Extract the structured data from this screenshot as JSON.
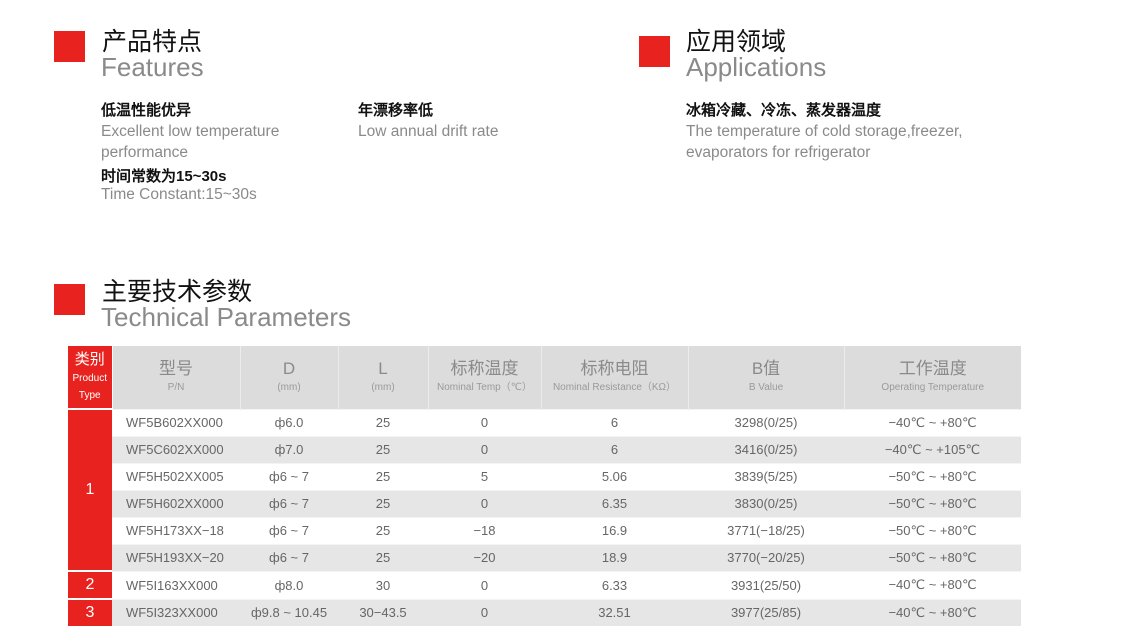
{
  "features": {
    "title_cn": "产品特点",
    "title_en": "Features",
    "items": [
      {
        "cn": "低温性能优异",
        "en": "Excellent low temperature performance"
      },
      {
        "cn": "年漂移率低",
        "en": "Low annual drift rate"
      },
      {
        "cn": "时间常数为15~30s",
        "en": "Time Constant:15~30s"
      }
    ]
  },
  "applications": {
    "title_cn": "应用领域",
    "title_en": "Applications",
    "item_cn": "冰箱冷藏、冷冻、蒸发器温度",
    "item_en": "The temperature of cold storage,freezer, evaporators for refrigerator"
  },
  "technical": {
    "title_cn": "主要技术参数",
    "title_en": "Technical Parameters"
  },
  "colors": {
    "accent": "#e8231f",
    "header_bg": "#dcdcdc",
    "stripe": "#e6e6e6"
  },
  "table": {
    "headers": [
      {
        "cn": "类别",
        "en1": "Product",
        "en2": "Type"
      },
      {
        "cn": "型号",
        "en": "P/N"
      },
      {
        "cn": "D",
        "en": "(mm)"
      },
      {
        "cn": "L",
        "en": "(mm)"
      },
      {
        "cn": "标称温度",
        "en": "Nominal Temp（℃）"
      },
      {
        "cn": "标称电阻",
        "en": "Nominal Resistance（KΩ）"
      },
      {
        "cn": "B值",
        "en": "B Value"
      },
      {
        "cn": "工作温度",
        "en": "Operating Temperature"
      }
    ],
    "categories": [
      "1",
      "2",
      "3"
    ],
    "rows": [
      {
        "pn": "WF5B602XX000",
        "d": "ф6.0",
        "l": "25",
        "temp": "0",
        "res": "6",
        "b": "3298(0/25)",
        "op": "−40℃ ~ +80℃"
      },
      {
        "pn": "WF5C602XX000",
        "d": "ф7.0",
        "l": "25",
        "temp": "0",
        "res": "6",
        "b": "3416(0/25)",
        "op": "−40℃ ~ +105℃"
      },
      {
        "pn": "WF5H502XX005",
        "d": "ф6 ~ 7",
        "l": "25",
        "temp": "5",
        "res": "5.06",
        "b": "3839(5/25)",
        "op": "−50℃ ~ +80℃"
      },
      {
        "pn": "WF5H602XX000",
        "d": "ф6 ~ 7",
        "l": "25",
        "temp": "0",
        "res": "6.35",
        "b": "3830(0/25)",
        "op": "−50℃ ~ +80℃"
      },
      {
        "pn": "WF5H173XX−18",
        "d": "ф6 ~ 7",
        "l": "25",
        "temp": "−18",
        "res": "16.9",
        "b": "3771(−18/25)",
        "op": "−50℃ ~ +80℃"
      },
      {
        "pn": "WF5H193XX−20",
        "d": "ф6 ~ 7",
        "l": "25",
        "temp": "−20",
        "res": "18.9",
        "b": "3770(−20/25)",
        "op": "−50℃ ~ +80℃"
      },
      {
        "pn": "WF5I163XX000",
        "d": "ф8.0",
        "l": "30",
        "temp": "0",
        "res": "6.33",
        "b": "3931(25/50)",
        "op": "−40℃ ~ +80℃"
      },
      {
        "pn": "WF5I323XX000",
        "d": "ф9.8 ~ 10.45",
        "l": "30−43.5",
        "temp": "0",
        "res": "32.51",
        "b": "3977(25/85)",
        "op": "−40℃ ~ +80℃"
      }
    ]
  }
}
